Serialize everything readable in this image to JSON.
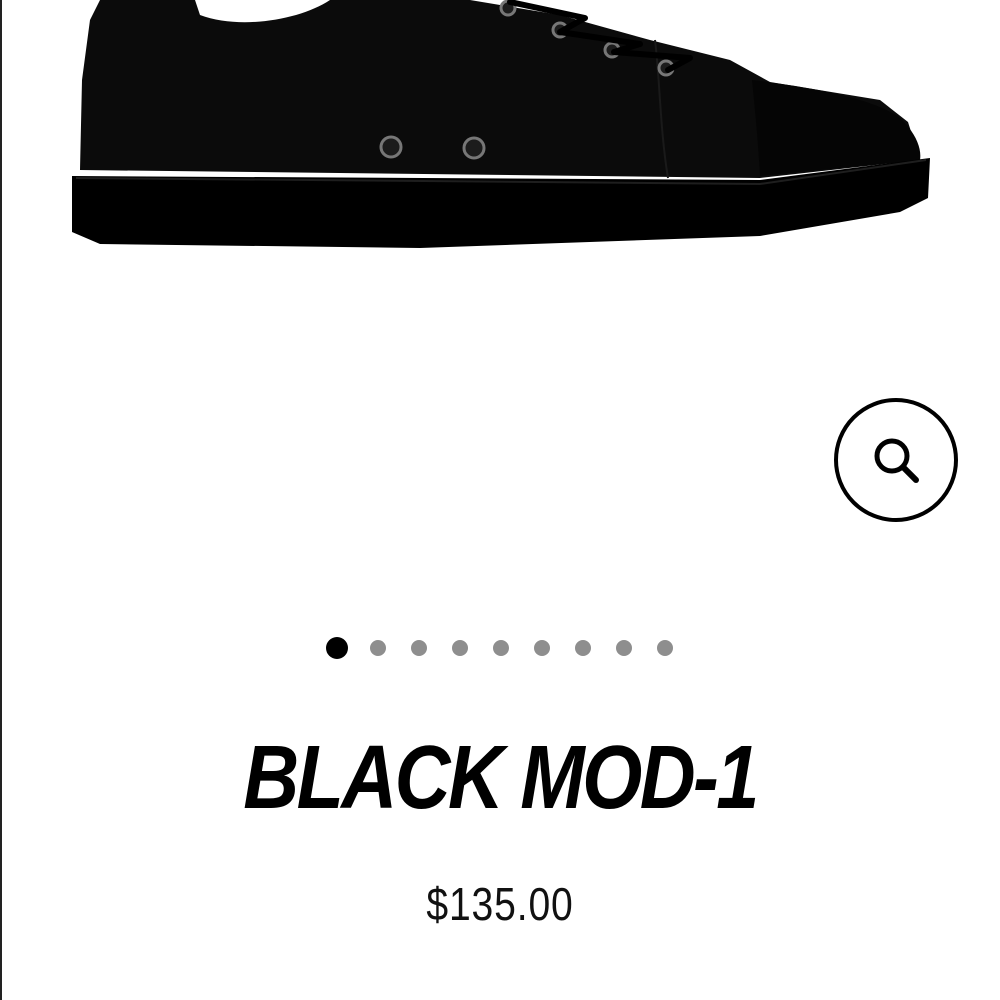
{
  "product": {
    "title": "BLACK MOD-1",
    "price": "$135.00",
    "image": {
      "icon": "sneaker-image",
      "color": "#000000"
    }
  },
  "zoom_button": {
    "icon": "magnifier-icon"
  },
  "carousel": {
    "slide_count": 9,
    "active_index": 0,
    "active_color": "#000000",
    "inactive_color": "#8e8e8e"
  }
}
